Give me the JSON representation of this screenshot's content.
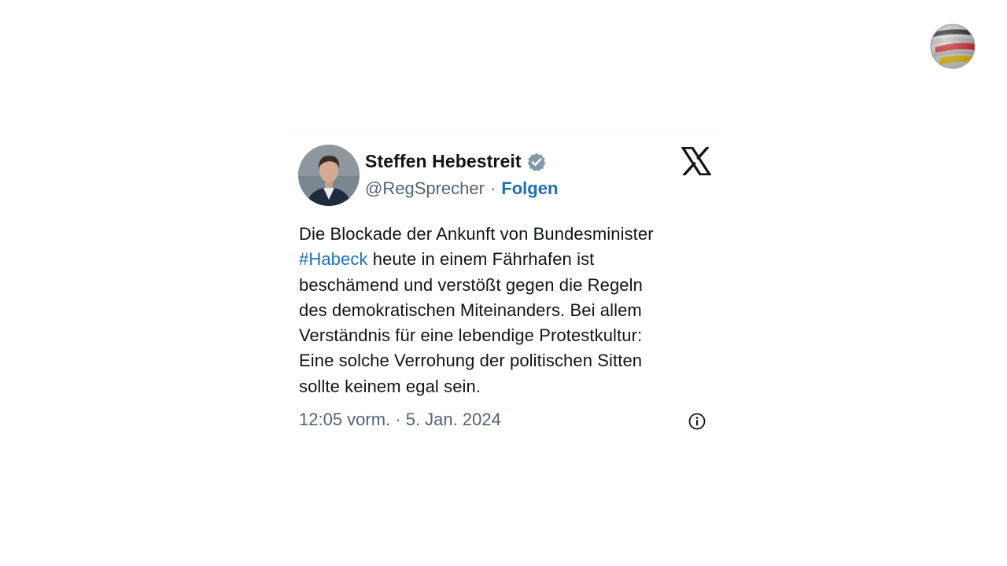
{
  "tweet": {
    "author_name": "Steffen Hebestreit",
    "handle": "@RegSprecher",
    "separator": "·",
    "follow_label": "Folgen",
    "text_lines": [
      {
        "before": "Die Blockade der Ankunft von Bundesminister",
        "hashtag": "",
        "after": ""
      },
      {
        "before": "",
        "hashtag": "#Habeck",
        "after": " heute in einem Fährhafen ist"
      },
      {
        "before": "beschämend und verstößt gegen die Regeln",
        "hashtag": "",
        "after": ""
      },
      {
        "before": "des demokratischen Miteinanders. Bei allem",
        "hashtag": "",
        "after": ""
      },
      {
        "before": "Verständnis für eine lebendige Protestkultur:",
        "hashtag": "",
        "after": ""
      },
      {
        "before": "Eine solche Verrohung der politischen Sitten",
        "hashtag": "",
        "after": ""
      },
      {
        "before": "sollte keinem egal sein.",
        "hashtag": "",
        "after": ""
      }
    ],
    "timestamp": "12:05 vorm. · 5. Jan. 2024"
  },
  "icons": {
    "verified": "verified-badge-icon",
    "platform": "x-logo-icon",
    "info": "info-icon",
    "channel": "channel-logo"
  },
  "colors": {
    "link": "#1d6fb8",
    "text": "#0f1419",
    "secondary": "#536471",
    "verified_badge": "#829aab"
  }
}
